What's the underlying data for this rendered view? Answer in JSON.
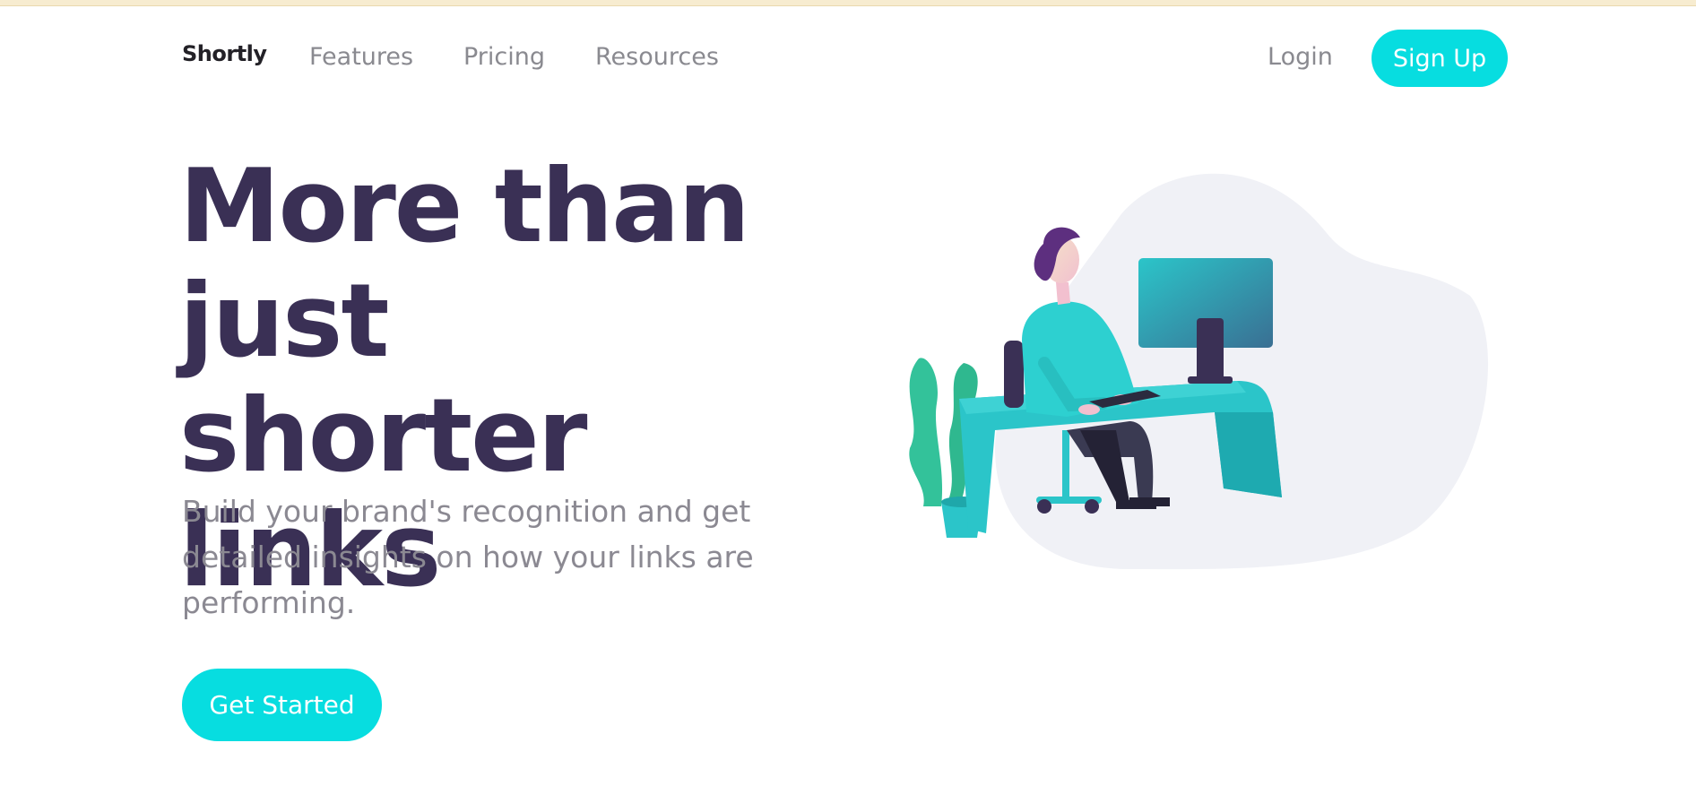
{
  "nav": {
    "brand": "Shortly",
    "links": [
      "Features",
      "Pricing",
      "Resources"
    ],
    "login": "Login",
    "signup": "Sign Up"
  },
  "hero": {
    "title": "More than just shorter links",
    "subtitle": "Build your brand's recognition and get detailed insights on how your links are performing.",
    "cta": "Get Started"
  },
  "colors": {
    "accent": "#07dde0",
    "heading": "#3a3055",
    "muted": "#8b8992",
    "blob": "#f0f1f6"
  },
  "illustration": {
    "icon": "person-working-at-desk-icon"
  }
}
